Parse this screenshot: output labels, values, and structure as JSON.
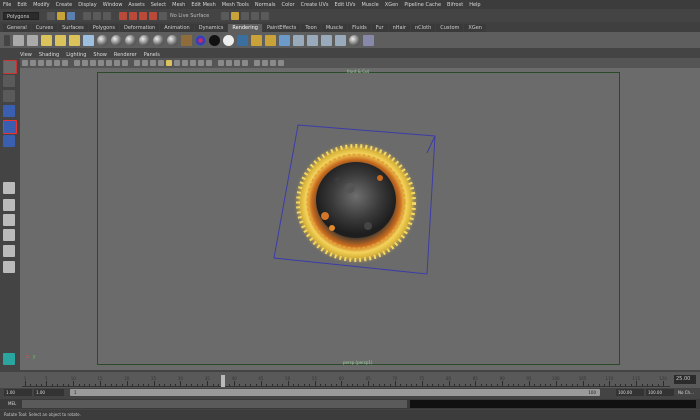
{
  "menu": [
    "File",
    "Edit",
    "Modify",
    "Create",
    "Display",
    "Window",
    "Assets",
    "Select",
    "Mesh",
    "Edit Mesh",
    "Mesh Tools",
    "Normals",
    "Color",
    "Create UVs",
    "Edit UVs",
    "Muscle",
    "XGen",
    "Pipeline Cache",
    "Bifrost",
    "Help"
  ],
  "status_line": {
    "mode": "Polygons",
    "live_surface": "No Live Surface"
  },
  "shelf_tabs": [
    "General",
    "Curves",
    "Surfaces",
    "Polygons",
    "Deformation",
    "Animation",
    "Dynamics",
    "Rendering",
    "PaintEffects",
    "Toon",
    "Muscle",
    "Fluids",
    "Fur",
    "nHair",
    "nCloth",
    "Custom",
    "XGen"
  ],
  "active_shelf_tab": "Rendering",
  "panel_menu": [
    "View",
    "Shading",
    "Lighting",
    "Show",
    "Renderer",
    "Panels"
  ],
  "viewport": {
    "camera_label": "front & Cut",
    "panel_label": "persp (persp1)",
    "axis_x": "x",
    "axis_y": "y"
  },
  "time_slider": {
    "ticks": [
      1,
      5,
      10,
      15,
      20,
      25,
      30,
      35,
      40,
      45,
      50,
      55,
      60,
      65,
      70,
      75,
      80,
      85,
      90,
      95,
      100,
      105,
      110,
      115,
      120
    ],
    "playhead_frame": 38,
    "current_frame": "25.00"
  },
  "range_slider": {
    "start": "1.00",
    "playback_start": "1.00",
    "range_left": "1",
    "range_right": "100",
    "playback_end": "100.00",
    "end": "100.00",
    "char_set": "No Ch..."
  },
  "command_line": {
    "label": "MEL"
  },
  "help_line": {
    "text": "Rotate Tool: Select an object to rotate."
  }
}
